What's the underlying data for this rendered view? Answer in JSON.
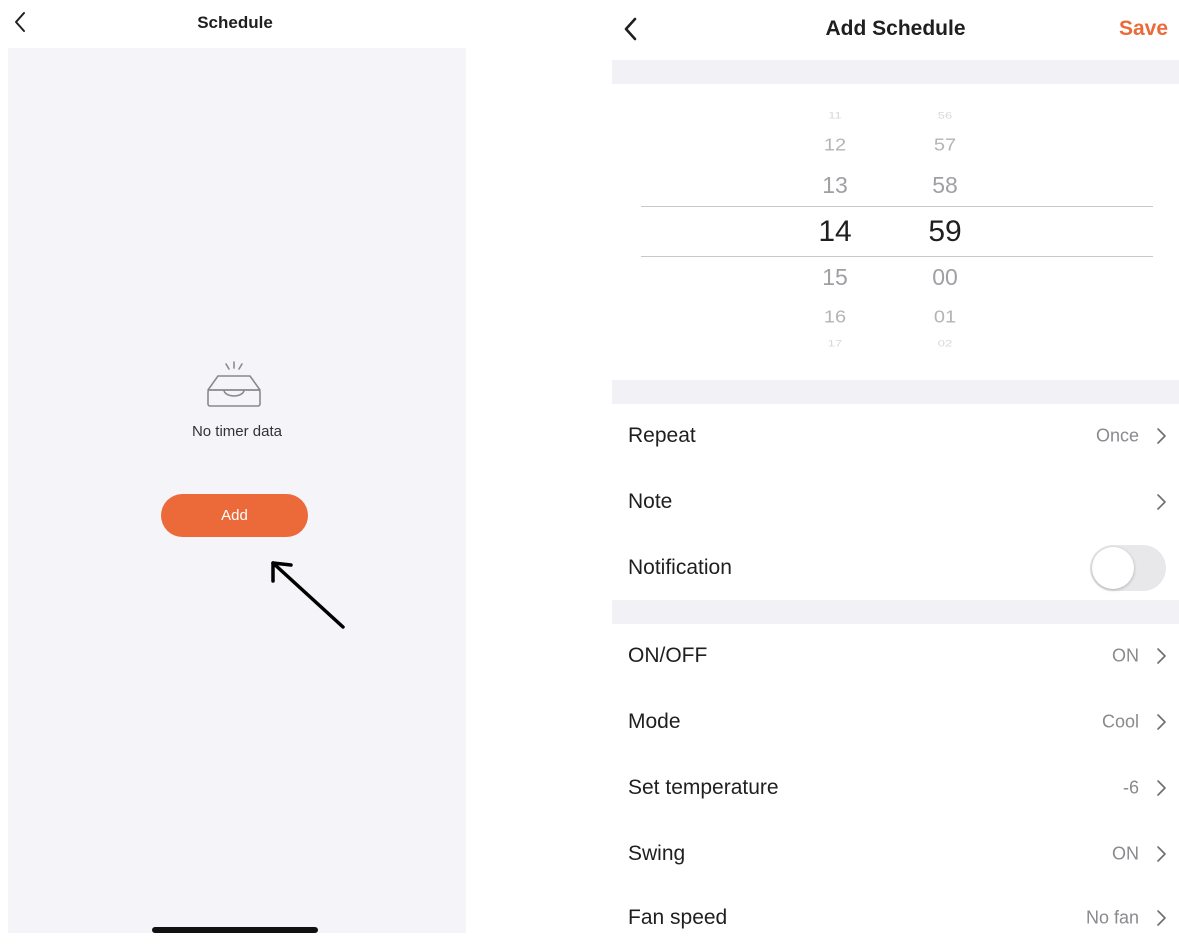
{
  "left": {
    "title": "Schedule",
    "empty_text": "No timer data",
    "add_label": "Add"
  },
  "right": {
    "title": "Add Schedule",
    "save_label": "Save",
    "hours": [
      "11",
      "12",
      "13",
      "14",
      "15",
      "16",
      "17"
    ],
    "minutes": [
      "56",
      "57",
      "58",
      "59",
      "00",
      "01",
      "02"
    ],
    "settings": [
      {
        "label": "Repeat",
        "value": "Once"
      },
      {
        "label": "Note",
        "value": ""
      },
      {
        "label": "Notification",
        "toggle": false
      }
    ],
    "device": [
      {
        "label": "ON/OFF",
        "value": "ON"
      },
      {
        "label": "Mode",
        "value": "Cool"
      },
      {
        "label": "Set temperature",
        "value": "-6"
      },
      {
        "label": "Swing",
        "value": "ON"
      },
      {
        "label": "Fan speed",
        "value": "No fan"
      }
    ]
  },
  "colors": {
    "accent": "#ec6a3a",
    "background": "#f5f5f9",
    "secondary_text": "#8a8a8e"
  },
  "icons": [
    "chevron-left-icon",
    "empty-inbox-icon",
    "chevron-right-icon",
    "arrow-pointer-icon"
  ]
}
